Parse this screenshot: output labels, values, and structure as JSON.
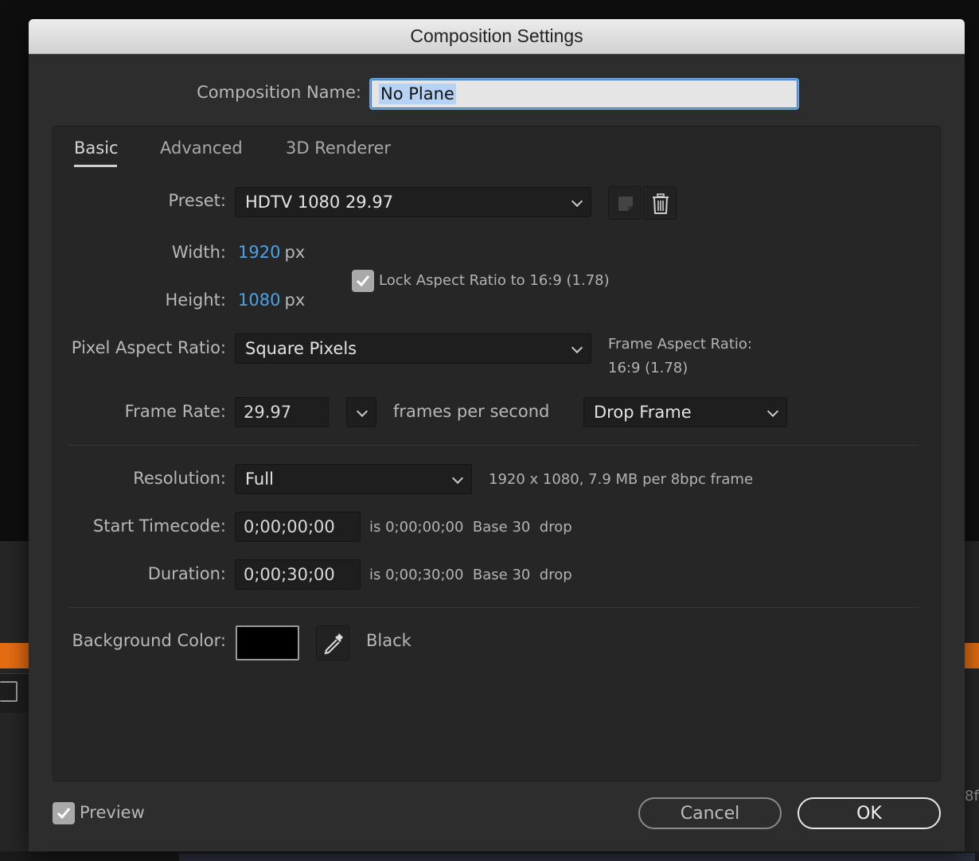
{
  "dialog": {
    "title": "Composition Settings",
    "comp_name_label": "Composition Name:",
    "comp_name_value": "No Plane"
  },
  "tabs": [
    {
      "label": "Basic",
      "active": true
    },
    {
      "label": "Advanced",
      "active": false
    },
    {
      "label": "3D Renderer",
      "active": false
    }
  ],
  "basic": {
    "preset_label": "Preset:",
    "preset_value": "HDTV 1080 29.97",
    "width_label": "Width:",
    "width_value": "1920",
    "height_label": "Height:",
    "height_value": "1080",
    "unit_px": "px",
    "lock_aspect_label": "Lock Aspect Ratio to 16:9 (1.78)",
    "lock_aspect_checked": true,
    "par_label": "Pixel Aspect Ratio:",
    "par_value": "Square Pixels",
    "frame_aspect_label": "Frame Aspect Ratio:",
    "frame_aspect_value": "16:9 (1.78)",
    "frame_rate_label": "Frame Rate:",
    "frame_rate_value": "29.97",
    "fps_label": "frames per second",
    "drop_frame_value": "Drop Frame",
    "resolution_label": "Resolution:",
    "resolution_value": "Full",
    "resolution_info": "1920 x 1080, 7.9 MB per 8bpc frame",
    "start_tc_label": "Start Timecode:",
    "start_tc_value": "0;00;00;00",
    "start_tc_info": "is 0;00;00;00  Base 30  drop",
    "duration_label": "Duration:",
    "duration_value": "0;00;30;00",
    "duration_info": "is 0;00;30;00  Base 30  drop",
    "bg_color_label": "Background Color:",
    "bg_color_hex": "#000000",
    "bg_color_name": "Black"
  },
  "footer": {
    "preview_label": "Preview",
    "preview_checked": true,
    "cancel_label": "Cancel",
    "ok_label": "OK"
  },
  "background": {
    "right_edge_text": "8f"
  },
  "icons": {
    "save_preset": "save-preset-icon",
    "delete_preset": "trash-icon",
    "eyedropper": "eyedropper-icon",
    "chevron": "chevron-down-icon",
    "check": "checkmark-icon"
  },
  "colors": {
    "accent_blue": "#4aa3ea",
    "dialog_bg": "#2d2d2d",
    "panel_bg": "#262626",
    "orange": "#e46d12"
  }
}
